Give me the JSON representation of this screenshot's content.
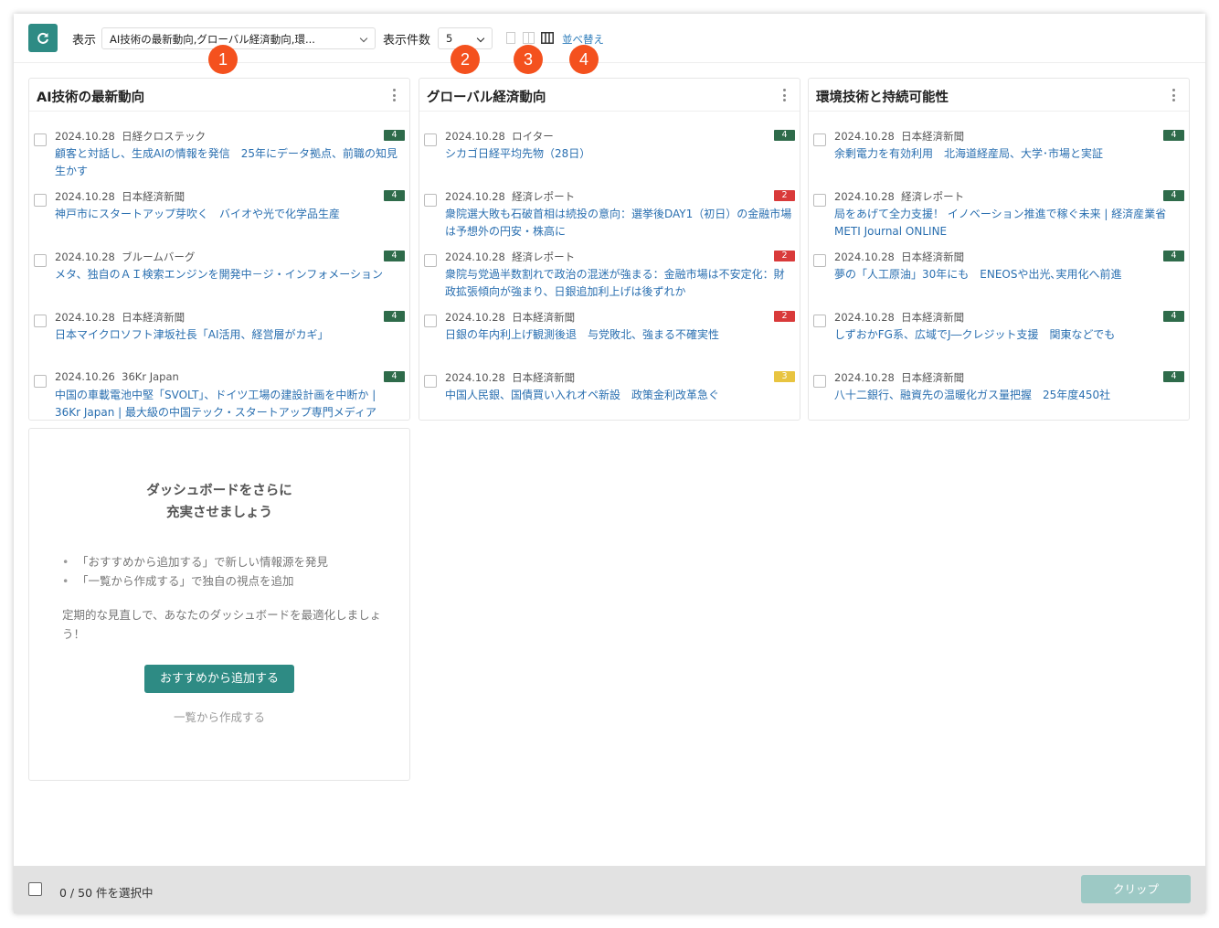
{
  "toolbar": {
    "display_label": "表示",
    "display_value": "AI技術の最新動向,グローバル経済動向,環...",
    "count_label": "表示件数",
    "count_value": "5",
    "sort_label": "並べ替え"
  },
  "markers": [
    "1",
    "2",
    "3",
    "4"
  ],
  "columns": [
    {
      "title": "AI技術の最新動向",
      "items": [
        {
          "date": "2024.10.28",
          "source": "日経クロステック",
          "badge": "4",
          "headline": "顧客と対話し、生成AIの情報を発信　25年にデータ拠点、前職の知見生かす"
        },
        {
          "date": "2024.10.28",
          "source": "日本経済新聞",
          "badge": "4",
          "headline": "神戸市にスタートアップ芽吹く　バイオや光で化学品生産"
        },
        {
          "date": "2024.10.28",
          "source": "ブルームバーグ",
          "badge": "4",
          "headline": "メタ、独自のＡＩ検索エンジンを開発中－ジ・インフォメーション"
        },
        {
          "date": "2024.10.28",
          "source": "日本経済新聞",
          "badge": "4",
          "headline": "日本マイクロソフト津坂社長「AI活用、経営層がカギ」"
        },
        {
          "date": "2024.10.26",
          "source": "36Kr Japan",
          "badge": "4",
          "headline": "中国の車載電池中堅「SVOLT」、ドイツ工場の建設計画を中断か | 36Kr Japan | 最大級の中国テック・スタートアップ専門メディア"
        }
      ]
    },
    {
      "title": "グローバル経済動向",
      "items": [
        {
          "date": "2024.10.28",
          "source": "ロイター",
          "badge": "4",
          "headline": "シカゴ日経平均先物（28日）"
        },
        {
          "date": "2024.10.28",
          "source": "経済レポート",
          "badge": "2",
          "headline": "衆院選大敗も石破首相は続投の意向：選挙後DAY1（初日）の金融市場は予想外の円安・株高に"
        },
        {
          "date": "2024.10.28",
          "source": "経済レポート",
          "badge": "2",
          "headline": "衆院与党過半数割れで政治の混迷が強まる：金融市場は不安定化：財政拡張傾向が強まり、日銀追加利上げは後ずれか"
        },
        {
          "date": "2024.10.28",
          "source": "日本経済新聞",
          "badge": "2",
          "headline": "日銀の年内利上げ観測後退　与党敗北、強まる不確実性"
        },
        {
          "date": "2024.10.28",
          "source": "日本経済新聞",
          "badge": "3",
          "headline": "中国人民銀、国債買い入れオペ新設　政策金利改革急ぐ"
        }
      ]
    },
    {
      "title": "環境技術と持続可能性",
      "items": [
        {
          "date": "2024.10.28",
          "source": "日本経済新聞",
          "badge": "4",
          "headline": "余剰電力を有効利用　北海道経産局、大学･市場と実証"
        },
        {
          "date": "2024.10.28",
          "source": "経済レポート",
          "badge": "4",
          "headline": "局をあげて全力支援！ イノベーション推進で稼ぐ未来 | 経済産業省 METI Journal ONLINE"
        },
        {
          "date": "2024.10.28",
          "source": "日本経済新聞",
          "badge": "4",
          "headline": "夢の「人工原油」30年にも　ENEOSや出光､実用化へ前進"
        },
        {
          "date": "2024.10.28",
          "source": "日本経済新聞",
          "badge": "4",
          "headline": "しずおかFG系、広域でJ―クレジット支援　関東などでも"
        },
        {
          "date": "2024.10.28",
          "source": "日本経済新聞",
          "badge": "4",
          "headline": "八十二銀行、融資先の温暖化ガス量把握　25年度450社"
        }
      ]
    }
  ],
  "promo": {
    "title_line1": "ダッシュボードをさらに",
    "title_line2": "充実させましょう",
    "bullet1": "「おすすめから追加する」で新しい情報源を発見",
    "bullet2": "「一覧から作成する」で独自の視点を追加",
    "desc": "定期的な見直しで、あなたのダッシュボードを最適化しましょう！",
    "primary_button": "おすすめから追加する",
    "secondary_link": "一覧から作成する"
  },
  "footer": {
    "selection_text": "0 / 50 件を選択中",
    "clip_button": "クリップ"
  },
  "colors": {
    "accent": "#2e8b84",
    "marker": "#f4511e",
    "badge_4": "#2e6b4a",
    "badge_2": "#d93a3a",
    "badge_3": "#e8c440",
    "link": "#2a6fb0"
  }
}
